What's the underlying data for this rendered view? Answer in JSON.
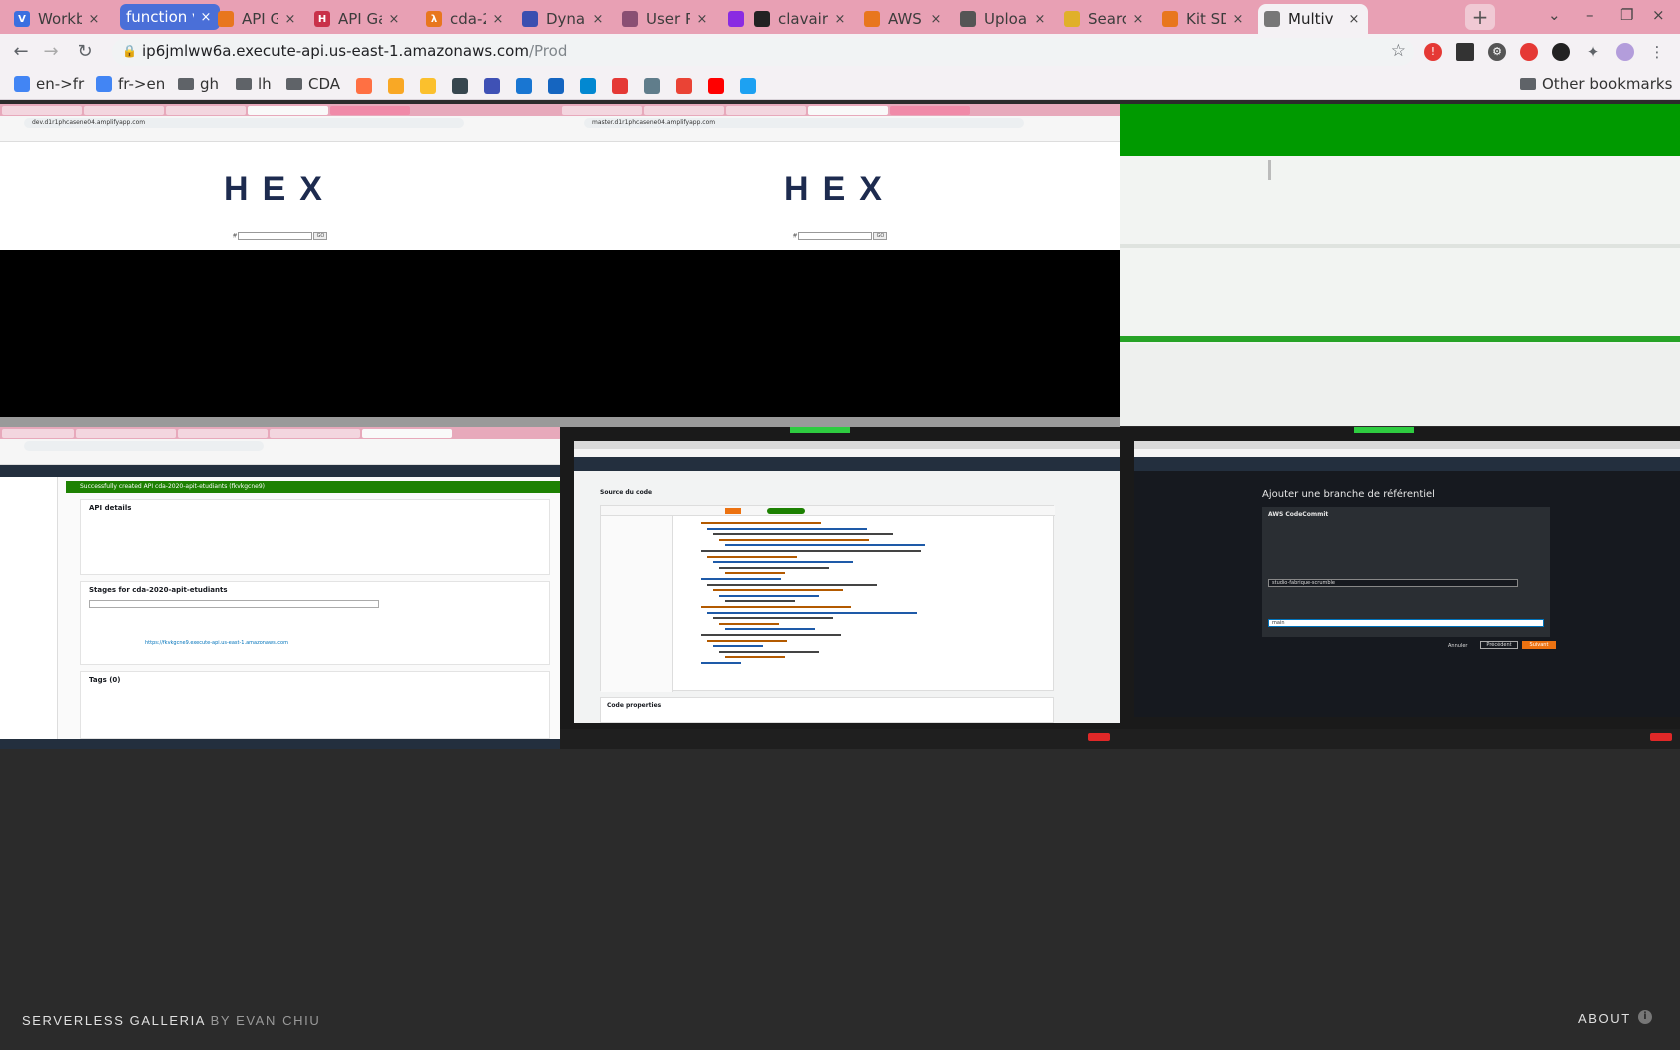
{
  "browser": {
    "tabs": [
      {
        "title": "Workb",
        "color": "#3b6fe0",
        "letter": "V"
      },
      {
        "title": "function v1",
        "color": "#4a6fd8",
        "letter": "",
        "highlighted": true
      },
      {
        "title": "API Ga",
        "color": "#e8761e",
        "letter": ""
      },
      {
        "title": "API Ga",
        "color": "#c9314a",
        "letter": "H"
      },
      {
        "title": "cda-20",
        "color": "#e8761e",
        "letter": "λ"
      },
      {
        "title": "Dynam",
        "color": "#3b4fb0",
        "letter": ""
      },
      {
        "title": "User P",
        "color": "#8a4f73",
        "letter": ""
      },
      {
        "title": "",
        "color": "#8a2be2",
        "letter": ""
      },
      {
        "title": "clavair",
        "color": "#222222",
        "letter": ""
      },
      {
        "title": "AWS A",
        "color": "#e8761e",
        "letter": ""
      },
      {
        "title": "Uploa",
        "color": "#555555",
        "letter": ""
      },
      {
        "title": "Search",
        "color": "#e0b02a",
        "letter": ""
      },
      {
        "title": "Kit SDI",
        "color": "#e8761e",
        "letter": ""
      },
      {
        "title": "Multiv",
        "color": "#777777",
        "letter": "",
        "active": true
      }
    ],
    "url_host": "ip6jmlww6a.execute-api.us-east-1.amazonaws.com",
    "url_path": "/Prod",
    "bookmarks": [
      {
        "label": "en->fr",
        "type": "icon",
        "color": "#4285f4"
      },
      {
        "label": "fr->en",
        "type": "icon",
        "color": "#4285f4"
      },
      {
        "label": "gh",
        "type": "folder"
      },
      {
        "label": "lh",
        "type": "folder"
      },
      {
        "label": "CDA",
        "type": "folder"
      }
    ],
    "bookmark_icons": [
      "#ff7043",
      "#f9a825",
      "#fbc02d",
      "#37474f",
      "#3f51b5",
      "#1976d2",
      "#1565c0",
      "#0288d1",
      "#e53935",
      "#607d8b",
      "#ea4335",
      "#ff0000",
      "#1da1f2"
    ],
    "other_bookmarks": "Other bookmarks"
  },
  "grid": {
    "hex_logo": "HEX",
    "hex_prefix": "#",
    "hex_go": "GO",
    "hex_url_1": "dev.d1r1phcasene04.amplifyapp.com",
    "hex_url_2": "master.d1r1phcasene04.amplifyapp.com",
    "api_banner": "Successfully created API cda-2020-apit-etudiants (fkvkgcne9)",
    "api_details_title": "API details",
    "api_stages_title": "Stages for cda-2020-apit-etudiants",
    "api_tags_title": "Tags (0)",
    "api_invoke_url": "https://fkvkgcne9.execute-api.us-east-1.amazonaws.com",
    "code_title": "Source du code",
    "code_props": "Code properties",
    "amplify_title": "Ajouter une branche de référentiel",
    "amplify_sub": "AWS CodeCommit",
    "amplify_repo": "studio-fabrique-scrumble",
    "amplify_branch": "main",
    "amplify_cancel": "Annuler",
    "amplify_prev": "Précédent",
    "amplify_next": "Suivant"
  },
  "footer": {
    "brand": "SERVERLESS GALLERIA",
    "by": "BY EVAN CHIU",
    "about": "ABOUT",
    "info_icon": "i"
  }
}
